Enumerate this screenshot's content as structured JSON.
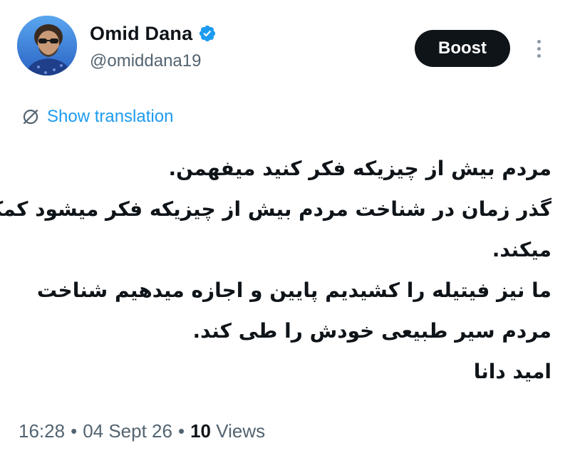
{
  "author": {
    "display_name": "Omid Dana",
    "handle": "@omiddana19",
    "verified": true,
    "verified_icon": "verified-badge-icon",
    "avatar": "profile-photo"
  },
  "actions": {
    "boost_label": "Boost",
    "more_icon": "more-vertical-icon"
  },
  "translation": {
    "icon": "translate-icon",
    "label": "Show translation"
  },
  "body": {
    "lines": [
      "مردم بیش از چیزیکه فکر کنید میفهمن.",
      "گذر زمان در شناخت مردم بیش از چیزیکه فکر میشود کمک",
      "میکند.",
      "ما نیز فیتیله را کشیدیم پایین و اجازه میدهیم شناخت",
      "مردم سیر طبیعی خودش را طی کند.",
      "امید دانا"
    ]
  },
  "meta": {
    "time": "16:28",
    "date": "04 Sept 26",
    "views_count": "10",
    "views_label": "Views",
    "separator": "•"
  },
  "colors": {
    "link": "#1d9bf0",
    "secondary_text": "#536471",
    "primary_text": "#0f1419",
    "button_bg": "#0f1419",
    "verified": "#1d9bf0"
  }
}
